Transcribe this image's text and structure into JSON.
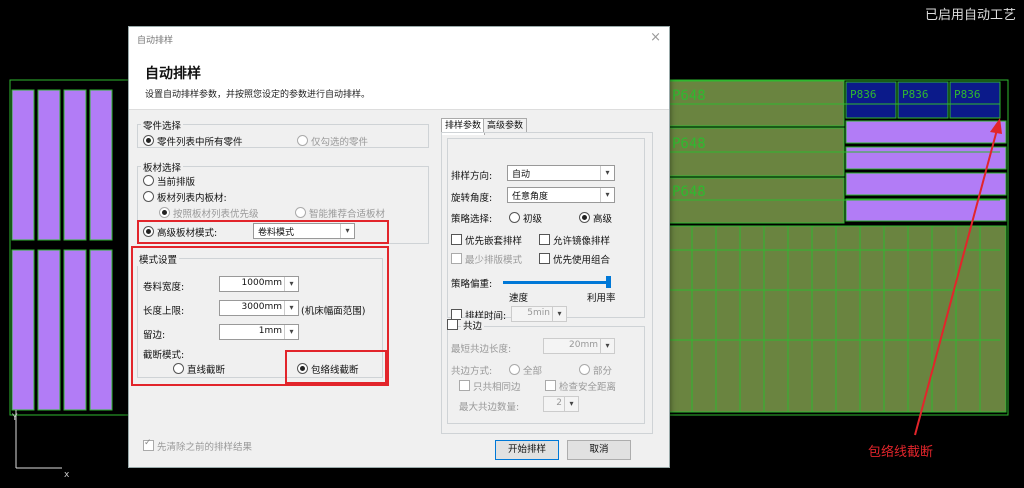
{
  "app": {
    "status": "已启用自动工艺",
    "annotation": "包络线截断",
    "axis_x": "x",
    "axis_y": "Y"
  },
  "canvas_labels": {
    "part_a": "P648",
    "part_b": "P836"
  },
  "dialog": {
    "window_title": "自动排样",
    "close_glyph": "×",
    "title": "自动排样",
    "description": "设置自动排样参数，并按照您设定的参数进行自动排样。",
    "parts": {
      "group_label": "零件选择",
      "all_parts": "零件列表中所有零件",
      "checked_only": "仅勾选的零件"
    },
    "sheet": {
      "group_label": "板材选择",
      "current": "当前排版",
      "from_list": "板材列表内板材:",
      "by_priority": "按照板材列表优先级",
      "smart": "智能推荐合适板材",
      "advanced_mode_label": "高级板材模式:",
      "advanced_mode_value": "卷料模式"
    },
    "mode": {
      "group_label": "模式设置",
      "width_label": "卷料宽度:",
      "width_value": "1000mm",
      "length_label": "长度上限:",
      "length_value": "3000mm",
      "length_note": "(机床幅面范围)",
      "margin_label": "留边:",
      "margin_value": "1mm",
      "cut_label": "截断模式:",
      "cut_straight": "直线截断",
      "cut_envelope": "包络线截断"
    },
    "clear_previous": "先清除之前的排样结果",
    "tabs": [
      "排样参数",
      "高级参数"
    ],
    "params": {
      "direction_label": "排样方向:",
      "direction_value": "自动",
      "rotation_label": "旋转角度:",
      "rotation_value": "任意角度",
      "strategy_label": "策略选择:",
      "strategy_basic": "初级",
      "strategy_advanced": "高级",
      "nest_first": "优先嵌套排样",
      "allow_mirror": "允许镜像排样",
      "min_sheet": "最少排版模式",
      "use_combo": "优先使用组合",
      "bias_label": "策略偏重:",
      "bias_speed": "速度",
      "bias_util": "利用率",
      "bias_value": 1.0,
      "time_label": "排样时间:",
      "time_value": "5min"
    },
    "common_edge": {
      "label": "共边",
      "min_len_label": "最短共边长度:",
      "min_len_value": "20mm",
      "method_label": "共边方式:",
      "method_all": "全部",
      "method_partial": "部分",
      "same_edge_only": "只共相同边",
      "check_safe": "检查安全距离",
      "max_count_label": "最大共边数量:",
      "max_count_value": "2"
    },
    "start_button": "开始排样",
    "cancel_button": "取消"
  },
  "colors": {
    "canvas_green": "#2fb92f",
    "part_purple": "#b27cf6",
    "part_olive": "#6a8440",
    "part_navy": "#0b1a8a",
    "annotation_red": "#e2252b",
    "accent_blue": "#0078d7"
  }
}
